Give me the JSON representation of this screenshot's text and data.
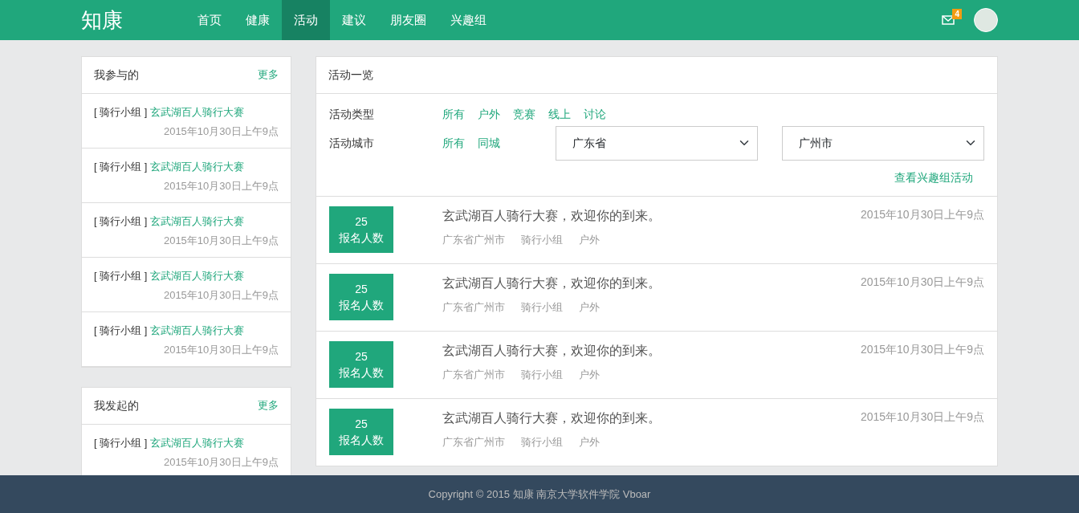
{
  "brand": "知康",
  "nav": [
    {
      "label": "首页",
      "selected": false
    },
    {
      "label": "健康",
      "selected": false
    },
    {
      "label": "活动",
      "selected": true
    },
    {
      "label": "建议",
      "selected": false
    },
    {
      "label": "朋友圈",
      "selected": false
    },
    {
      "label": "兴趣组",
      "selected": false
    }
  ],
  "mail_badge": "4",
  "sidebar": [
    {
      "title": "我参与的",
      "more": "更多",
      "items": [
        {
          "group": "[ 骑行小组 ]",
          "name": "玄武湖百人骑行大赛",
          "date": "2015年10月30日上午9点"
        },
        {
          "group": "[ 骑行小组 ]",
          "name": "玄武湖百人骑行大赛",
          "date": "2015年10月30日上午9点"
        },
        {
          "group": "[ 骑行小组 ]",
          "name": "玄武湖百人骑行大赛",
          "date": "2015年10月30日上午9点"
        },
        {
          "group": "[ 骑行小组 ]",
          "name": "玄武湖百人骑行大赛",
          "date": "2015年10月30日上午9点"
        },
        {
          "group": "[ 骑行小组 ]",
          "name": "玄武湖百人骑行大赛",
          "date": "2015年10月30日上午9点"
        }
      ]
    },
    {
      "title": "我发起的",
      "more": "更多",
      "items": [
        {
          "group": "[ 骑行小组 ]",
          "name": "玄武湖百人骑行大赛",
          "date": "2015年10月30日上午9点"
        }
      ]
    }
  ],
  "main": {
    "title": "活动一览",
    "type_filter": {
      "label": "活动类型",
      "options": [
        "所有",
        "户外",
        "竞赛",
        "线上",
        "讨论"
      ]
    },
    "city_filter": {
      "label": "活动城市",
      "options": [
        "所有",
        "同城"
      ],
      "province": "广东省",
      "city": "广州市"
    },
    "group_link": "查看兴趣组活动",
    "activities": [
      {
        "count": "25",
        "count_label": "报名人数",
        "title": "玄武湖百人骑行大赛，欢迎你的到来。",
        "date": "2015年10月30日上午9点",
        "tags": [
          "广东省广州市",
          "骑行小组",
          "户外"
        ]
      },
      {
        "count": "25",
        "count_label": "报名人数",
        "title": "玄武湖百人骑行大赛，欢迎你的到来。",
        "date": "2015年10月30日上午9点",
        "tags": [
          "广东省广州市",
          "骑行小组",
          "户外"
        ]
      },
      {
        "count": "25",
        "count_label": "报名人数",
        "title": "玄武湖百人骑行大赛，欢迎你的到来。",
        "date": "2015年10月30日上午9点",
        "tags": [
          "广东省广州市",
          "骑行小组",
          "户外"
        ]
      },
      {
        "count": "25",
        "count_label": "报名人数",
        "title": "玄武湖百人骑行大赛，欢迎你的到来。",
        "date": "2015年10月30日上午9点",
        "tags": [
          "广东省广州市",
          "骑行小组",
          "户外"
        ]
      }
    ]
  },
  "footer": "Copyright © 2015 知康 南京大学软件学院 Vboar"
}
